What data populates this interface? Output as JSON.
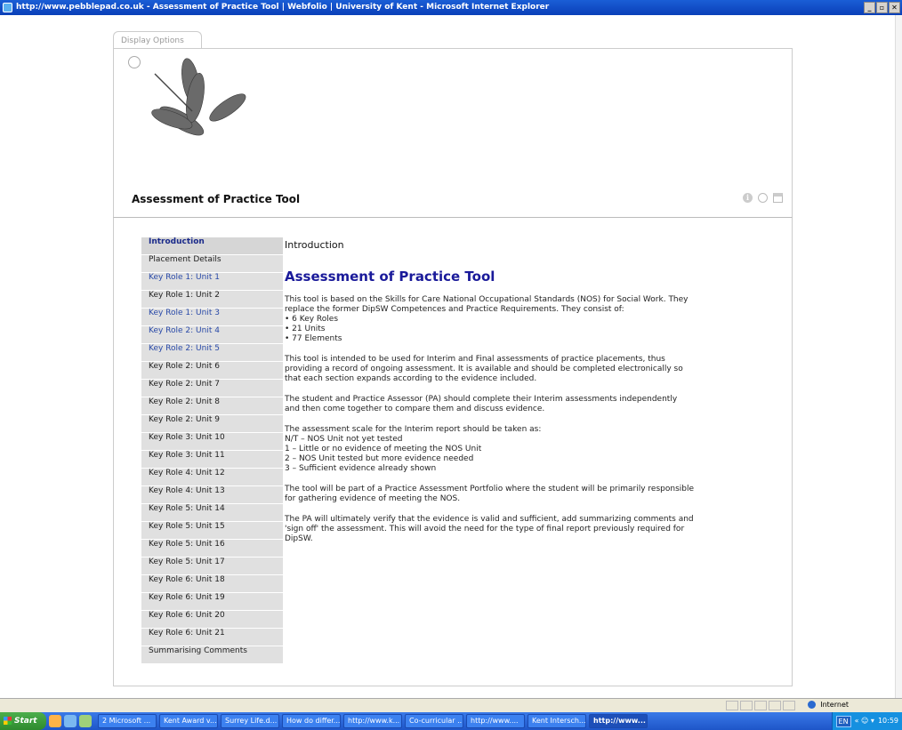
{
  "window": {
    "title": "http://www.pebblepad.co.uk - Assessment of Practice Tool | Webfolio | University of Kent - Microsoft Internet Explorer",
    "buttons": [
      "_",
      "▫",
      "✕"
    ]
  },
  "tab": {
    "label": "Display Options"
  },
  "header": {
    "title": "Assessment of Practice Tool",
    "info_glyph": "i"
  },
  "nav": {
    "items": [
      {
        "label": "Introduction",
        "state": "active"
      },
      {
        "label": "Placement Details",
        "state": "normal"
      },
      {
        "label": "Key Role 1: Unit 1",
        "state": "link"
      },
      {
        "label": "Key Role 1: Unit 2",
        "state": "normal"
      },
      {
        "label": "Key Role 1: Unit 3",
        "state": "link"
      },
      {
        "label": "Key Role 2: Unit 4",
        "state": "link"
      },
      {
        "label": "Key Role 2: Unit 5",
        "state": "link"
      },
      {
        "label": "Key Role 2: Unit 6",
        "state": "normal"
      },
      {
        "label": "Key Role 2: Unit 7",
        "state": "normal"
      },
      {
        "label": "Key Role 2: Unit 8",
        "state": "normal"
      },
      {
        "label": "Key Role 2: Unit 9",
        "state": "normal"
      },
      {
        "label": "Key Role 3: Unit 10",
        "state": "normal"
      },
      {
        "label": "Key Role 3: Unit 11",
        "state": "normal"
      },
      {
        "label": "Key Role 4: Unit 12",
        "state": "normal"
      },
      {
        "label": "Key Role 4: Unit 13",
        "state": "normal"
      },
      {
        "label": "Key Role 5: Unit 14",
        "state": "normal"
      },
      {
        "label": "Key Role 5: Unit 15",
        "state": "normal"
      },
      {
        "label": "Key Role 5: Unit 16",
        "state": "normal"
      },
      {
        "label": "Key Role 5: Unit 17",
        "state": "normal"
      },
      {
        "label": "Key Role 6: Unit 18",
        "state": "normal"
      },
      {
        "label": "Key Role 6: Unit 19",
        "state": "normal"
      },
      {
        "label": "Key Role 6: Unit 20",
        "state": "normal"
      },
      {
        "label": "Key Role 6: Unit 21",
        "state": "normal"
      },
      {
        "label": "Summarising Comments",
        "state": "normal"
      }
    ]
  },
  "main": {
    "section_title": "Introduction",
    "heading": "Assessment of Practice Tool",
    "paragraphs": [
      [
        "This tool is based on the Skills for Care National Occupational Standards (NOS) for Social Work. They",
        "replace the former DipSW Competences and Practice Requirements. They consist of:",
        "• 6 Key Roles",
        "• 21 Units",
        "• 77 Elements"
      ],
      [
        "This tool is intended to be used for Interim and Final assessments of practice placements, thus",
        "providing a record of ongoing assessment. It is available and should be completed electronically so",
        "that each section expands according to the evidence included."
      ],
      [
        "The student and Practice Assessor (PA) should complete their Interim assessments independently",
        "and then come together to compare them and discuss evidence."
      ],
      [
        "The assessment scale for the Interim report should be taken as:",
        "N/T – NOS Unit not yet tested",
        "1 – Little or no evidence of meeting the NOS Unit",
        "2 – NOS Unit tested but more evidence needed",
        "3 – Sufficient evidence already shown"
      ],
      [
        "The tool will be part of a Practice Assessment Portfolio where the student will be primarily responsible",
        "for gathering evidence of meeting the NOS."
      ],
      [
        "The PA will ultimately verify that the evidence is valid and sufficient, add summarizing comments and",
        "'sign off' the assessment. This will avoid the need for the type of final report previously required for",
        "DipSW."
      ]
    ]
  },
  "status": {
    "zone": "Internet"
  },
  "taskbar": {
    "start": "Start",
    "tasks": [
      {
        "label": "2 Microsoft ...",
        "width": 66
      },
      {
        "label": "Kent Award v...",
        "width": 66
      },
      {
        "label": "Surrey Life.d...",
        "width": 66
      },
      {
        "label": "How do differ...",
        "width": 66
      },
      {
        "label": "http://www.k...",
        "width": 66
      },
      {
        "label": "Co-curricular ...",
        "width": 66
      },
      {
        "label": "http://www....",
        "width": 66
      },
      {
        "label": "Kent Intersch...",
        "width": 66
      },
      {
        "label": "http://www...",
        "width": 66,
        "active": true
      }
    ],
    "lang": "EN",
    "clock": "10:59"
  }
}
